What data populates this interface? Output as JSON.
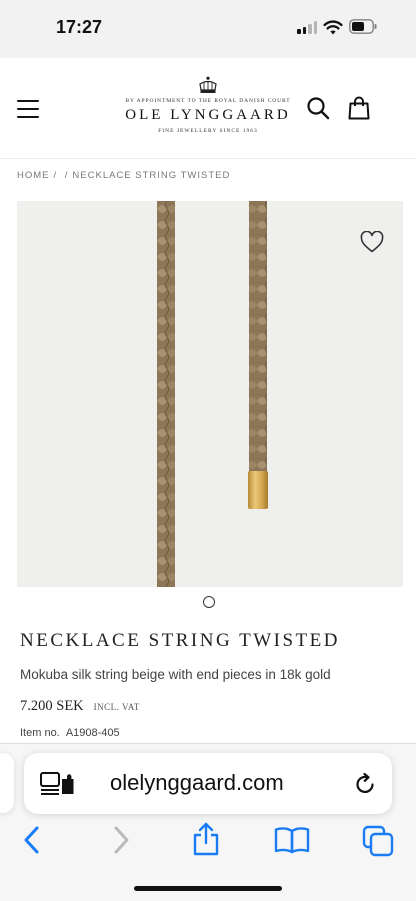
{
  "status_bar": {
    "time": "17:27"
  },
  "header": {
    "logo": {
      "court_line": "BY APPOINTMENT TO THE ROYAL DANISH COURT",
      "brand": "OLE LYNGGAARD",
      "tagline": "FINE JEWELLERY SINCE 1963"
    },
    "icons": {
      "menu": "hamburger-menu",
      "search": "magnifier",
      "bag": "shopping-bag"
    }
  },
  "breadcrumb": {
    "home": "HOME",
    "sep1": "/",
    "sep2": "/",
    "current": "NECKLACE STRING TWISTED"
  },
  "product": {
    "title": "NECKLACE STRING TWISTED",
    "description": "Mokuba silk string beige with end pieces in 18k gold",
    "price": "7.200 SEK",
    "vat": "INCL. VAT",
    "item_label": "Item no.",
    "item_number": "A1908-405",
    "image": {
      "subject": "beige braided silk string with gold end piece"
    }
  },
  "browser": {
    "url": "olelynggaard.com",
    "accent": "#1a7cf5"
  },
  "colors": {
    "string": "#9a8468",
    "gold": "#d6a94e",
    "image_bg": "#efefee"
  }
}
